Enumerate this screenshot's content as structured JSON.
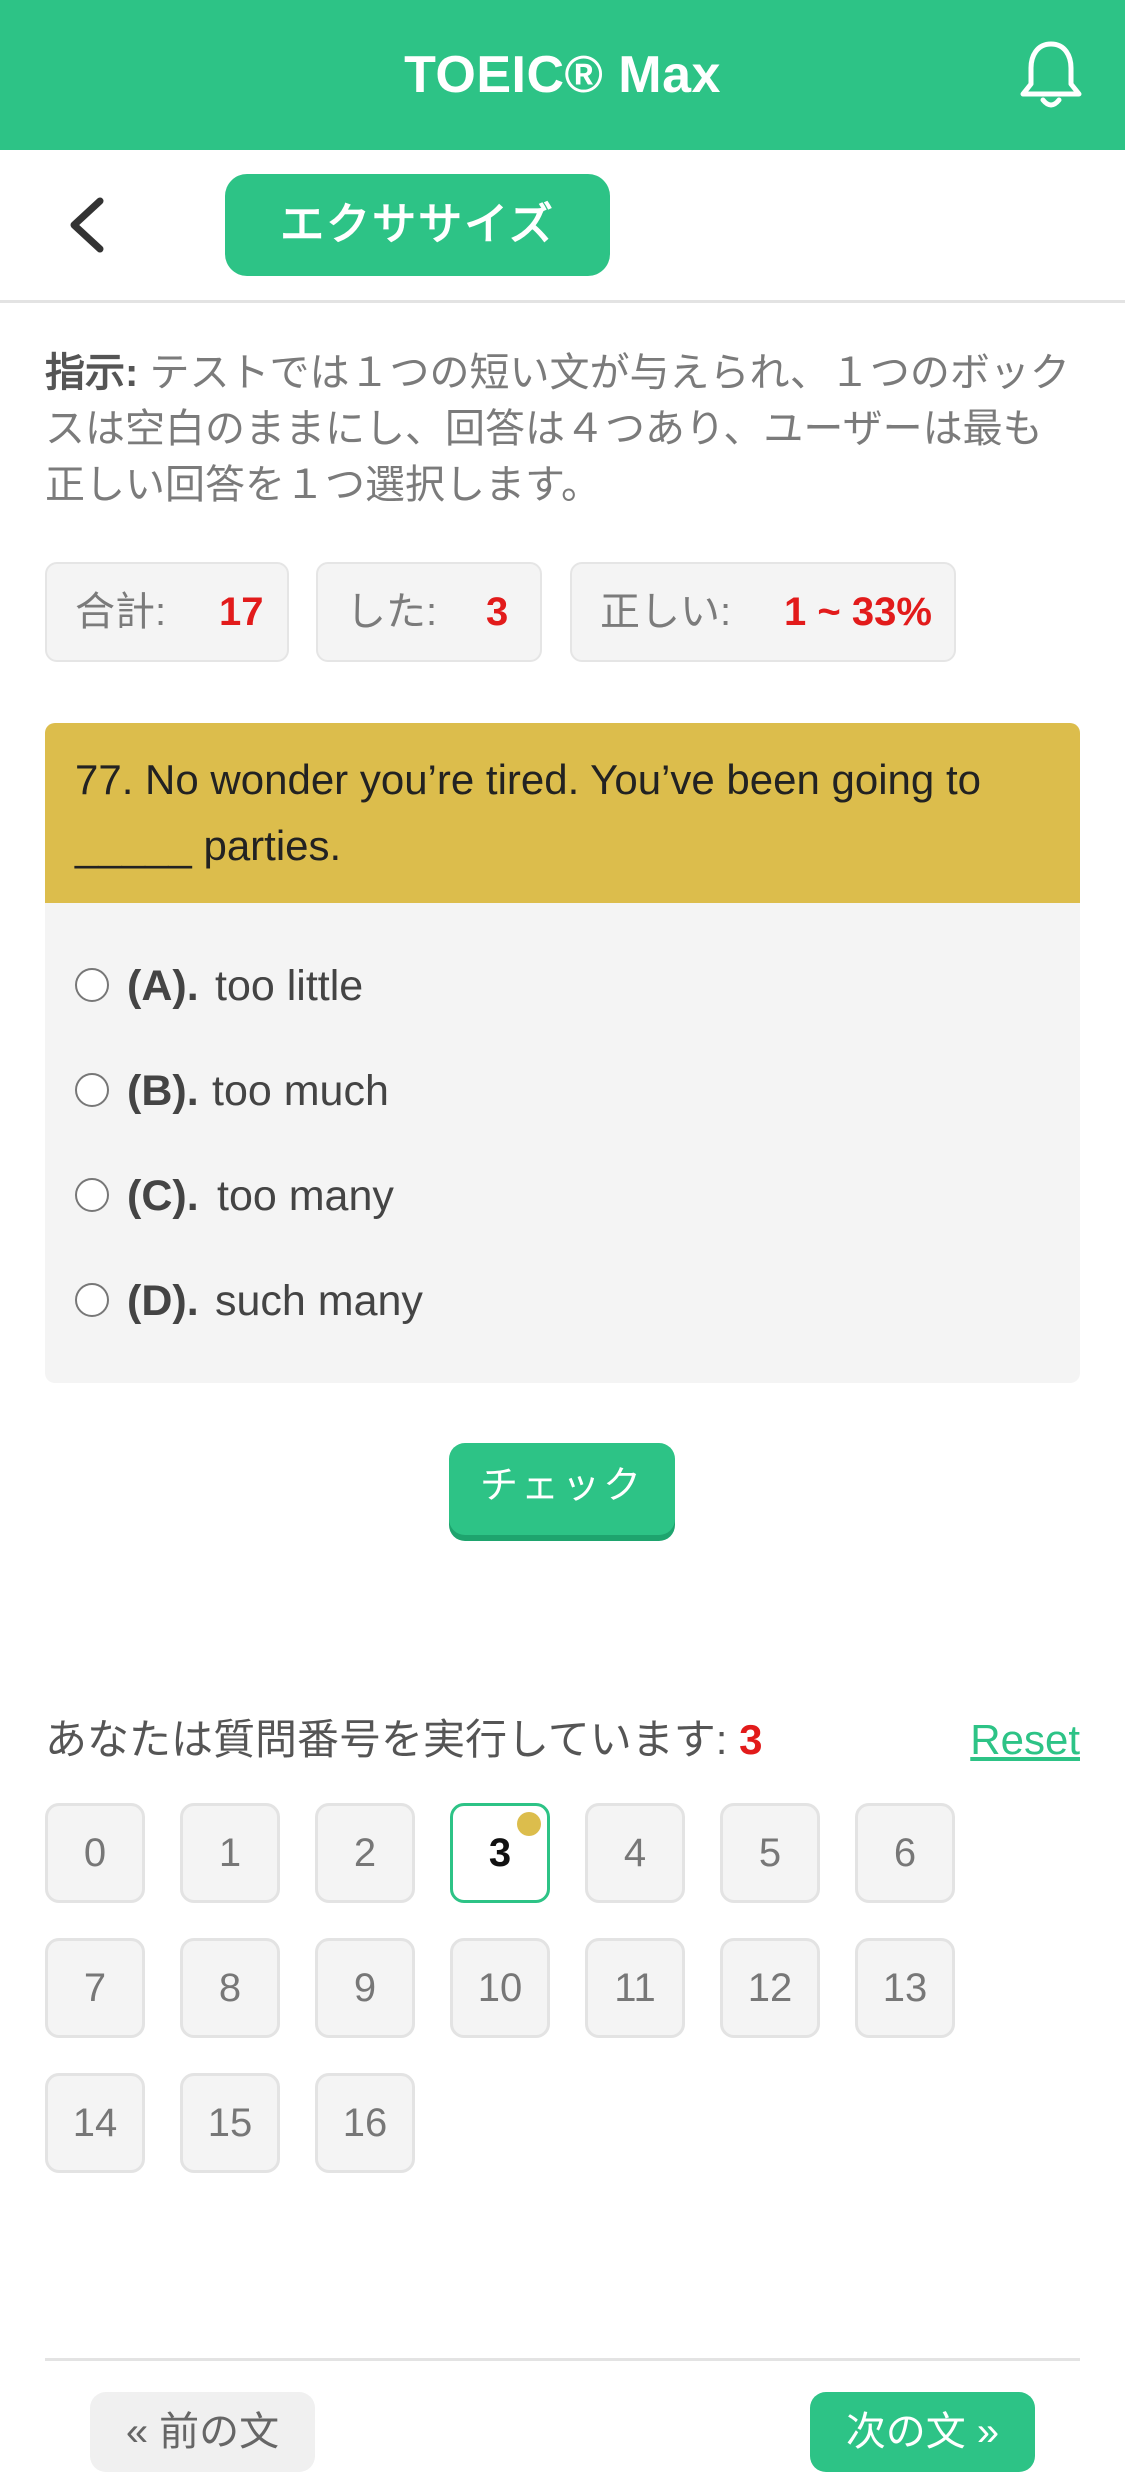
{
  "header": {
    "title": "TOEIC® Max",
    "notification_icon": "bell-icon"
  },
  "subheader": {
    "back_icon": "chevron-left-icon",
    "exercise_label": "エクササイズ"
  },
  "instructions": {
    "label": "指示:",
    "text": " テストでは１つの短い文が与えられ、１つのボックスは空白のままにし、回答は４つあり、ユーザーは最も正しい回答を１つ選択します。"
  },
  "stats": {
    "total_label": "合計:",
    "total_value": "17",
    "done_label": "した:",
    "done_value": "3",
    "correct_label": "正しい:",
    "correct_value": "1 ~ 33%"
  },
  "question": {
    "text": "77. No wonder you’re tired. You’ve been going to _____ parties.",
    "options": [
      {
        "letter": "(A).",
        "text": "too little"
      },
      {
        "letter": "(B).",
        "text": "too much"
      },
      {
        "letter": "(C).",
        "text": "too many"
      },
      {
        "letter": "(D).",
        "text": "such many"
      }
    ]
  },
  "check_label": "チェック",
  "progress": {
    "label": "あなたは質問番号を実行しています:",
    "current": "3",
    "reset_label": "Reset",
    "numbers": [
      "0",
      "1",
      "2",
      "3",
      "4",
      "5",
      "6",
      "7",
      "8",
      "9",
      "10",
      "11",
      "12",
      "13",
      "14",
      "15",
      "16"
    ]
  },
  "nav": {
    "prev_label": "« 前の文",
    "next_label": "次の文 »"
  },
  "colors": {
    "accent": "#2dc386",
    "question_header": "#dcbd4c",
    "highlight": "#e21b1b"
  }
}
